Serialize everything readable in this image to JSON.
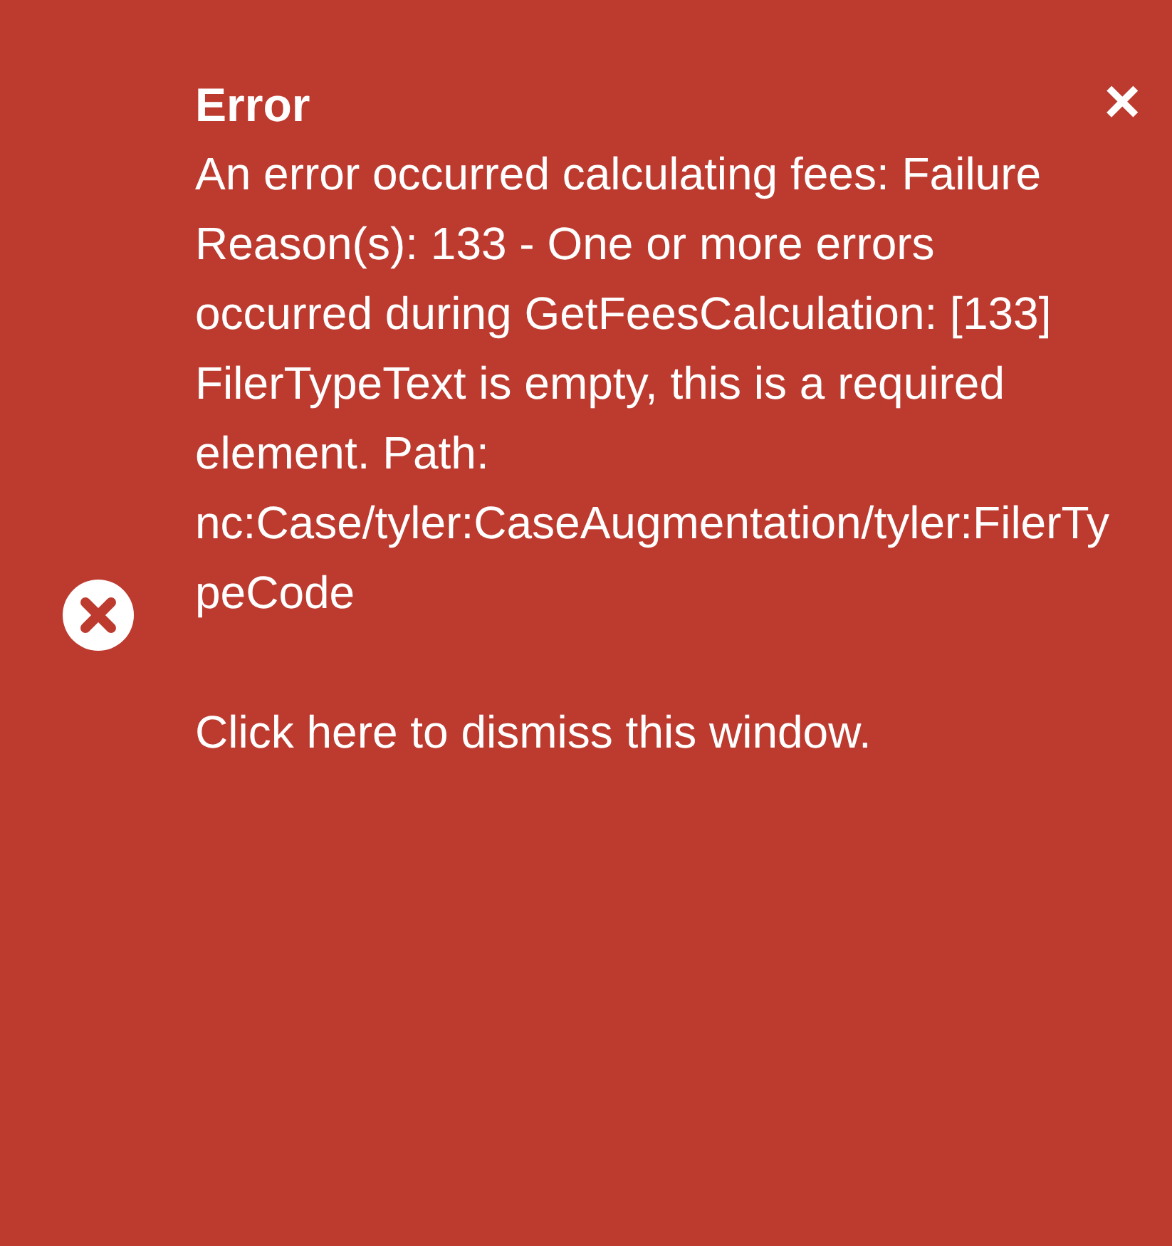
{
  "toast": {
    "kind": "error",
    "title": "Error",
    "close_label": "×",
    "message": "An error occurred calculating fees: Failure Reason(s): 133 - One or more errors occurred during GetFeesCalculation: [133] FilerTypeText is empty, this is a required element. Path: nc:Case/tyler:CaseAugmentation/tyler:FilerTypeCode",
    "dismiss_text": "Click here to dismiss this window."
  }
}
